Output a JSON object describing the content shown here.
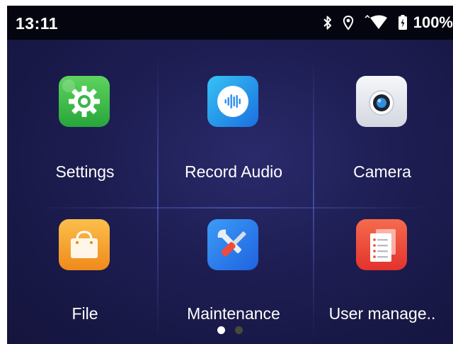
{
  "status_bar": {
    "time": "13:11",
    "battery_percent": "100%",
    "icons": [
      "bluetooth-icon",
      "location-icon",
      "wifi-icon",
      "battery-icon"
    ]
  },
  "apps": [
    {
      "label": "Settings",
      "icon": "gear-icon",
      "color": "#3fbd4d"
    },
    {
      "label": "Record Audio",
      "icon": "audio-wave-icon",
      "color": "#1e9ae8"
    },
    {
      "label": "Camera",
      "icon": "camera-icon",
      "color": "#e6e9f0"
    },
    {
      "label": "File",
      "icon": "shopping-bag-icon",
      "color": "#f7a534"
    },
    {
      "label": "Maintenance",
      "icon": "tools-icon",
      "color": "#2b7ff0"
    },
    {
      "label": "User manage..",
      "icon": "document-list-icon",
      "color": "#ec4a3a"
    }
  ],
  "pagination": {
    "pages": 2,
    "current": 1,
    "active_color": "#ffffff",
    "inactive_color": "#4a4a3a"
  }
}
